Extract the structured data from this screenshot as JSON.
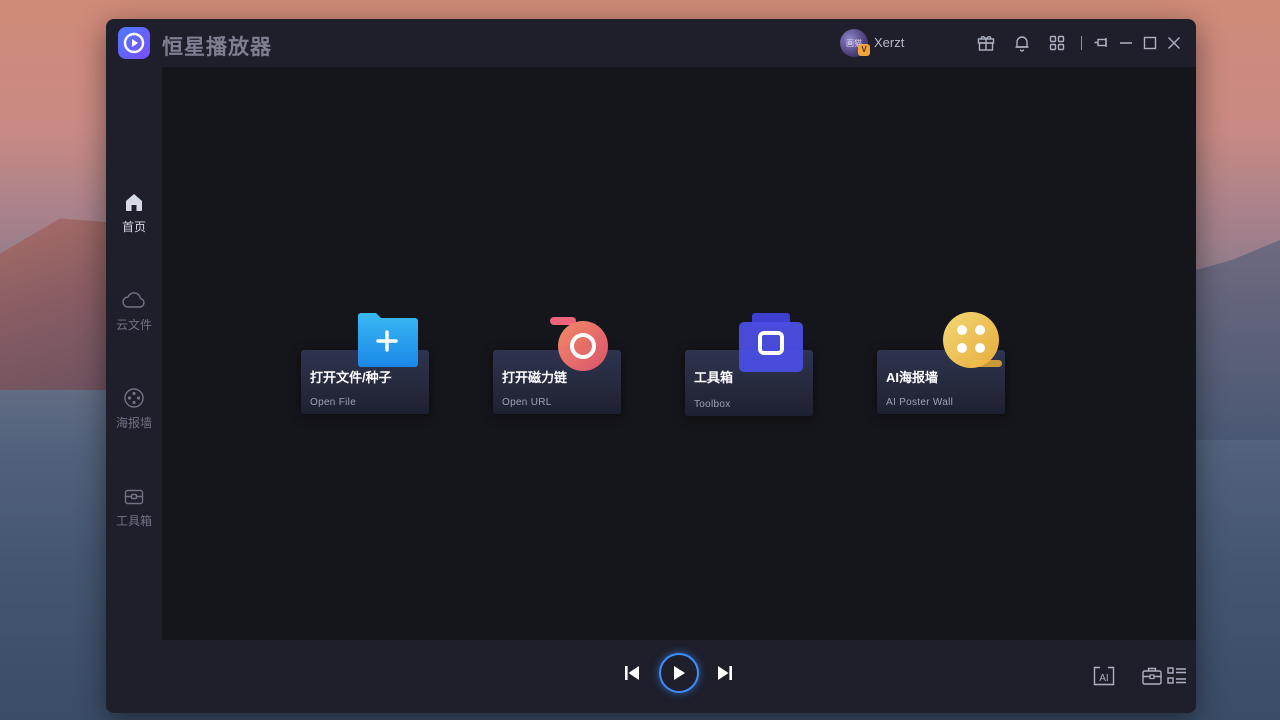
{
  "app": {
    "title": "恒星播放器",
    "username": "Xerzt",
    "avatar_text": "画猫",
    "vip_badge": "V"
  },
  "sidebar": {
    "items": [
      {
        "label": "首页",
        "icon": "home-icon",
        "active": true
      },
      {
        "label": "云文件",
        "icon": "cloud-icon",
        "active": false
      },
      {
        "label": "海报墙",
        "icon": "film-reel-icon",
        "active": false
      },
      {
        "label": "工具箱",
        "icon": "toolbox-icon",
        "active": false
      }
    ],
    "bottom_icon": "tv-icon"
  },
  "titlebar_icons": [
    "gift-icon",
    "bell-icon",
    "apps-grid-icon",
    "pin-icon",
    "minimize-icon",
    "maximize-icon",
    "close-icon"
  ],
  "cards": [
    {
      "title": "打开文件/种子",
      "subtitle": "Open File",
      "icon": "folder-add-icon"
    },
    {
      "title": "打开磁力链",
      "subtitle": "Open URL",
      "icon": "magnet-link-icon"
    },
    {
      "title": "工具箱",
      "subtitle": "Toolbox",
      "icon": "toolbox-icon"
    },
    {
      "title": "AI海报墙",
      "subtitle": "AI Poster Wall",
      "icon": "film-reel-icon"
    }
  ],
  "player": {
    "prev_icon": "skip-previous-icon",
    "play_icon": "play-icon",
    "next_icon": "skip-next-icon",
    "right_icons": [
      "ai-subtitle-icon",
      "toolbox-icon",
      "playlist-icon"
    ],
    "ai_label": "AI"
  },
  "colors": {
    "window_bg": "#1e1f2b",
    "content_bg": "#15151c",
    "accent": "#3d8dff"
  }
}
